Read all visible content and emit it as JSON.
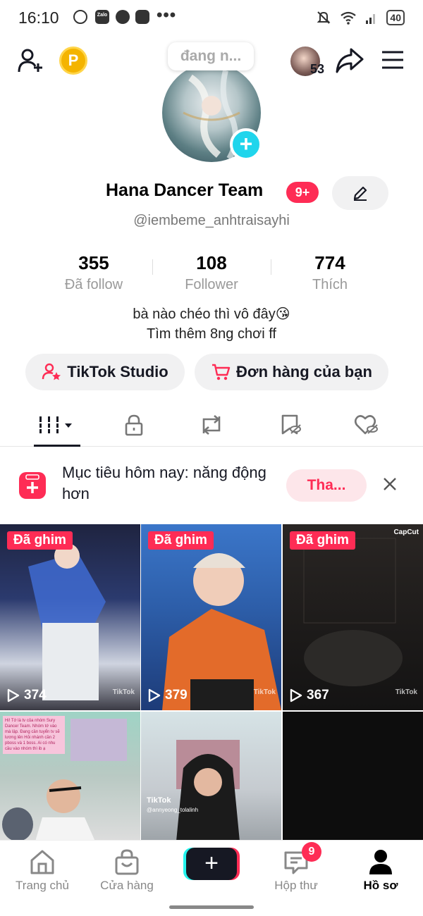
{
  "status_bar": {
    "time": "16:10",
    "zalo_label": "Zalo",
    "battery": "40"
  },
  "top_nav": {
    "coin_label": "P",
    "avatar_count": "53",
    "status_bubble": "đang n..."
  },
  "profile": {
    "name": "Hana Dancer Team",
    "name_badge": "9+",
    "handle": "@iembeme_anhtraisayhi",
    "stats": [
      {
        "value": "355",
        "label": "Đã follow"
      },
      {
        "value": "108",
        "label": "Follower"
      },
      {
        "value": "774",
        "label": "Thích"
      }
    ],
    "bio_lines": [
      "bà nào chéo thì vô đây😘",
      "Tìm thêm 8ng chơi ff"
    ]
  },
  "actions": {
    "studio_label": "TikTok Studio",
    "orders_label": "Đơn hàng của bạn"
  },
  "goal": {
    "text": "Mục tiêu hôm nay: năng động hơn",
    "button_label": "Tha..."
  },
  "videos": [
    {
      "pinned": "Đã ghim",
      "views": "374",
      "watermark": "TikTok"
    },
    {
      "pinned": "Đã ghim",
      "views": "379",
      "watermark": "TikTok"
    },
    {
      "pinned": "Đã ghim",
      "views": "367",
      "watermark": "TikTok",
      "capcut": "CapCut"
    },
    {
      "note": "Hi! Tớ là tv của nhóm Sury Dancer Team. Nhóm tớ vào mà lập. Đang cần tuyển tv sẽ lương lên Hỏi nhánh cần 2 pboss và 1 boss. Ai có nhu cầu vào nhóm thì ib ạ"
    },
    {
      "watermark": "TikTok",
      "handle": "@annyeong_tolalinh"
    },
    {}
  ],
  "bottom_nav": {
    "items": [
      {
        "label": "Trang chủ"
      },
      {
        "label": "Cửa hàng"
      },
      {
        "label": "+"
      },
      {
        "label": "Hộp thư",
        "badge": "9"
      },
      {
        "label": "Hồ sơ"
      }
    ]
  },
  "colors": {
    "accent": "#fe2c55",
    "cyan": "#25f4ee",
    "text": "#161823"
  }
}
